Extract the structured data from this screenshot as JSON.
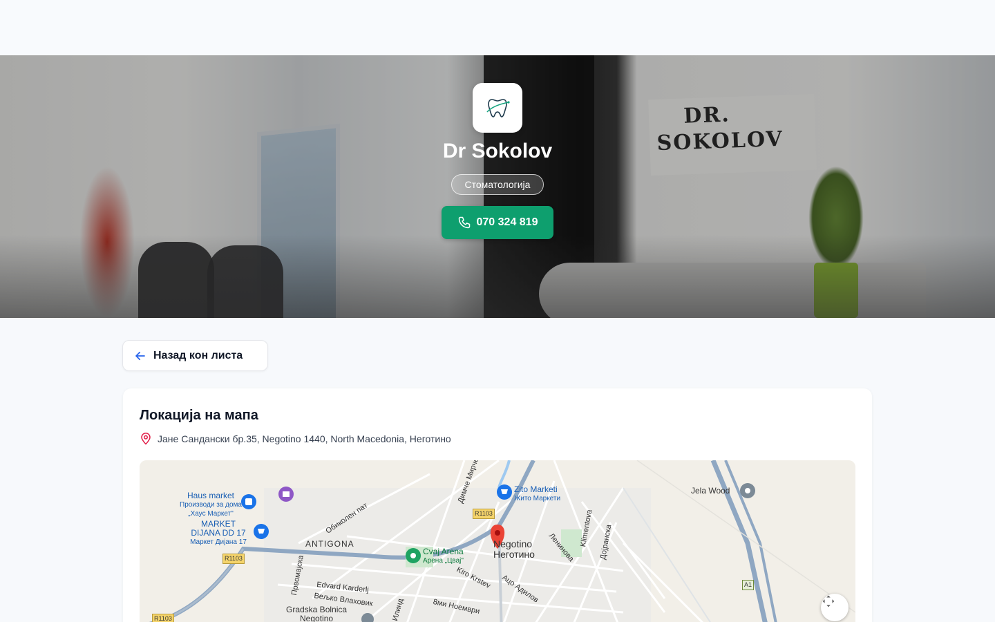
{
  "hero": {
    "clinic_name": "Dr Sokolov",
    "category": "Стоматологија",
    "phone": "070 324 819",
    "sign_text_line1": "DR.",
    "sign_text_line2": "SOKOLOV"
  },
  "nav": {
    "back_label": "Назад кон листа"
  },
  "location": {
    "title": "Локација на мапа",
    "address": "Јане Сандански бр.35, Negotino 1440, North Macedonia, Неготино"
  },
  "map": {
    "labels": {
      "haus_market": "Haus market",
      "haus_market_sub1": "Производи за дома",
      "haus_market_sub2": "„Хаус Маркет\"",
      "market_dijana_1": "MARKET",
      "market_dijana_2": "DIJANA DD 17",
      "market_dijana_sub": "Маркет Дијана 17",
      "antigona": "ANTIGONA",
      "obikolen": "Обиколен пат",
      "dimche": "Димче Мирчев",
      "zito_markets": "Zito Marketi",
      "zito_markets_sub": "Жито Маркети",
      "r1103_a": "R1103",
      "r1103_b": "R1103",
      "r1103_c": "R1103",
      "cvaj_arena": "Cvaj Arena",
      "cvaj_arena_sub": "Арена „Цвај\"",
      "negotino": "Negotino",
      "negotino_sub": "Неготино",
      "leninova": "Ленинова",
      "klimentova": "Klimentova",
      "dojranska": "Дојранска",
      "jela_wood": "Jela Wood",
      "a1": "A1",
      "pvomajska": "Првомајска",
      "edvard": "Edvard Karderlj",
      "velko": "Вељко Влаховик",
      "kiro": "Kiro Krstev",
      "aco": "Ацо Адилов",
      "noemvri": "8ми Ноември",
      "ilinden": "Илинд",
      "gradska_1": "Gradska Bolnica",
      "gradska_2": "Negotino"
    }
  }
}
